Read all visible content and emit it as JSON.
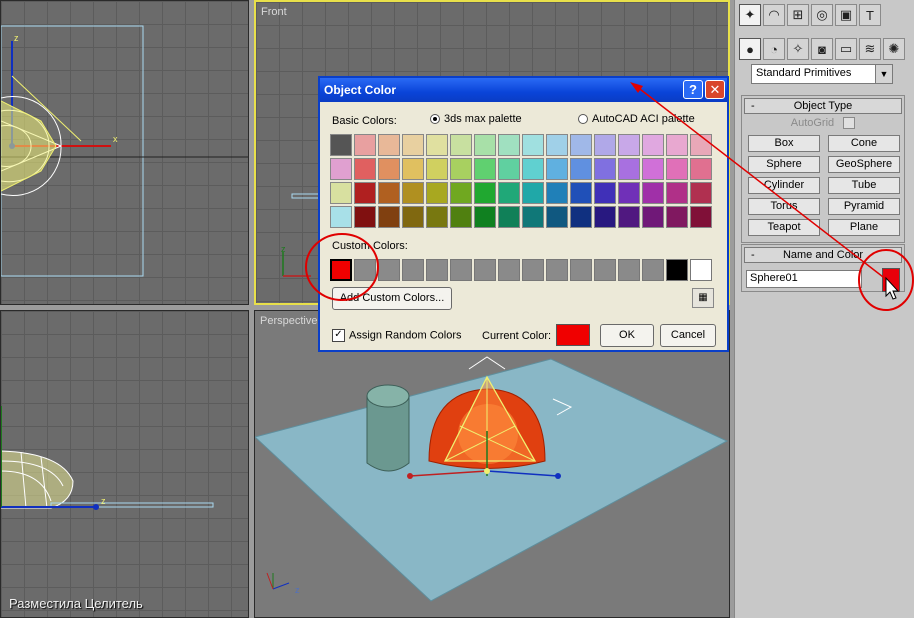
{
  "viewports": {
    "front_label": "Front",
    "perspective_label": "Perspective",
    "axis_z": "z",
    "axis_x": "x"
  },
  "watermark": "Разместила Целитель",
  "command_panel": {
    "category_dropdown": "Standard Primitives",
    "object_type": {
      "title": "Object Type",
      "autogrid_label": "AutoGrid",
      "buttons": [
        "Box",
        "Cone",
        "Sphere",
        "GeoSphere",
        "Cylinder",
        "Tube",
        "Torus",
        "Pyramid",
        "Teapot",
        "Plane"
      ]
    },
    "name_and_color": {
      "title": "Name and Color",
      "object_name": "Sphere01",
      "object_color": "#e8000a"
    }
  },
  "dialog": {
    "title": "Object Color",
    "help_button": "?",
    "close_button": "✕",
    "basic_colors_label": "Basic Colors:",
    "palette_options": [
      {
        "label": "3ds max palette",
        "selected": true
      },
      {
        "label": "AutoCAD ACI palette",
        "selected": false
      }
    ],
    "basic_colors": [
      [
        "#555555",
        "#e8a0a0",
        "#e8b898",
        "#e8d0a0",
        "#e0e0a0",
        "#c8e0a0",
        "#a8e0a8",
        "#a0e0c0",
        "#a0e0e0",
        "#a0d0e8",
        "#a0b8e8",
        "#b0a8e8",
        "#c8a8e8",
        "#e0a8e0",
        "#e8a8d0",
        "#e8a8b8"
      ],
      [
        "#e0a0d0",
        "#e06060",
        "#e09060",
        "#e0c060",
        "#d0d060",
        "#a8d060",
        "#60d070",
        "#60d0a0",
        "#60d0d0",
        "#60b0e0",
        "#6090e0",
        "#8070e0",
        "#a870e0",
        "#d070d8",
        "#e070b8",
        "#e07090"
      ],
      [
        "#d8e0a0",
        "#b02020",
        "#b06020",
        "#b09020",
        "#a8a820",
        "#70a820",
        "#20a830",
        "#20a878",
        "#20a8a8",
        "#2080b8",
        "#2050b8",
        "#4030b8",
        "#7030b8",
        "#a030a8",
        "#b03088",
        "#b03050"
      ],
      [
        "#a8e0e8",
        "#801010",
        "#804010",
        "#806810",
        "#787810",
        "#508010",
        "#108020",
        "#108058",
        "#107878",
        "#105880",
        "#103080",
        "#281880",
        "#501880",
        "#701878",
        "#801860",
        "#801038"
      ]
    ],
    "custom_colors_label": "Custom Colors:",
    "custom_colors": [
      "#f00000",
      "#8a8a8a",
      "#8a8a8a",
      "#8a8a8a",
      "#8a8a8a",
      "#8a8a8a",
      "#8a8a8a",
      "#8a8a8a",
      "#8a8a8a",
      "#8a8a8a",
      "#8a8a8a",
      "#8a8a8a",
      "#8a8a8a",
      "#8a8a8a",
      "#000000",
      "#ffffff"
    ],
    "add_custom_button": "Add Custom Colors...",
    "assign_random_label": "Assign Random Colors",
    "assign_random_checked": true,
    "current_color_label": "Current Color:",
    "current_color": "#f00000",
    "ok_button": "OK",
    "cancel_button": "Cancel"
  },
  "annotation_color": "#e00000"
}
